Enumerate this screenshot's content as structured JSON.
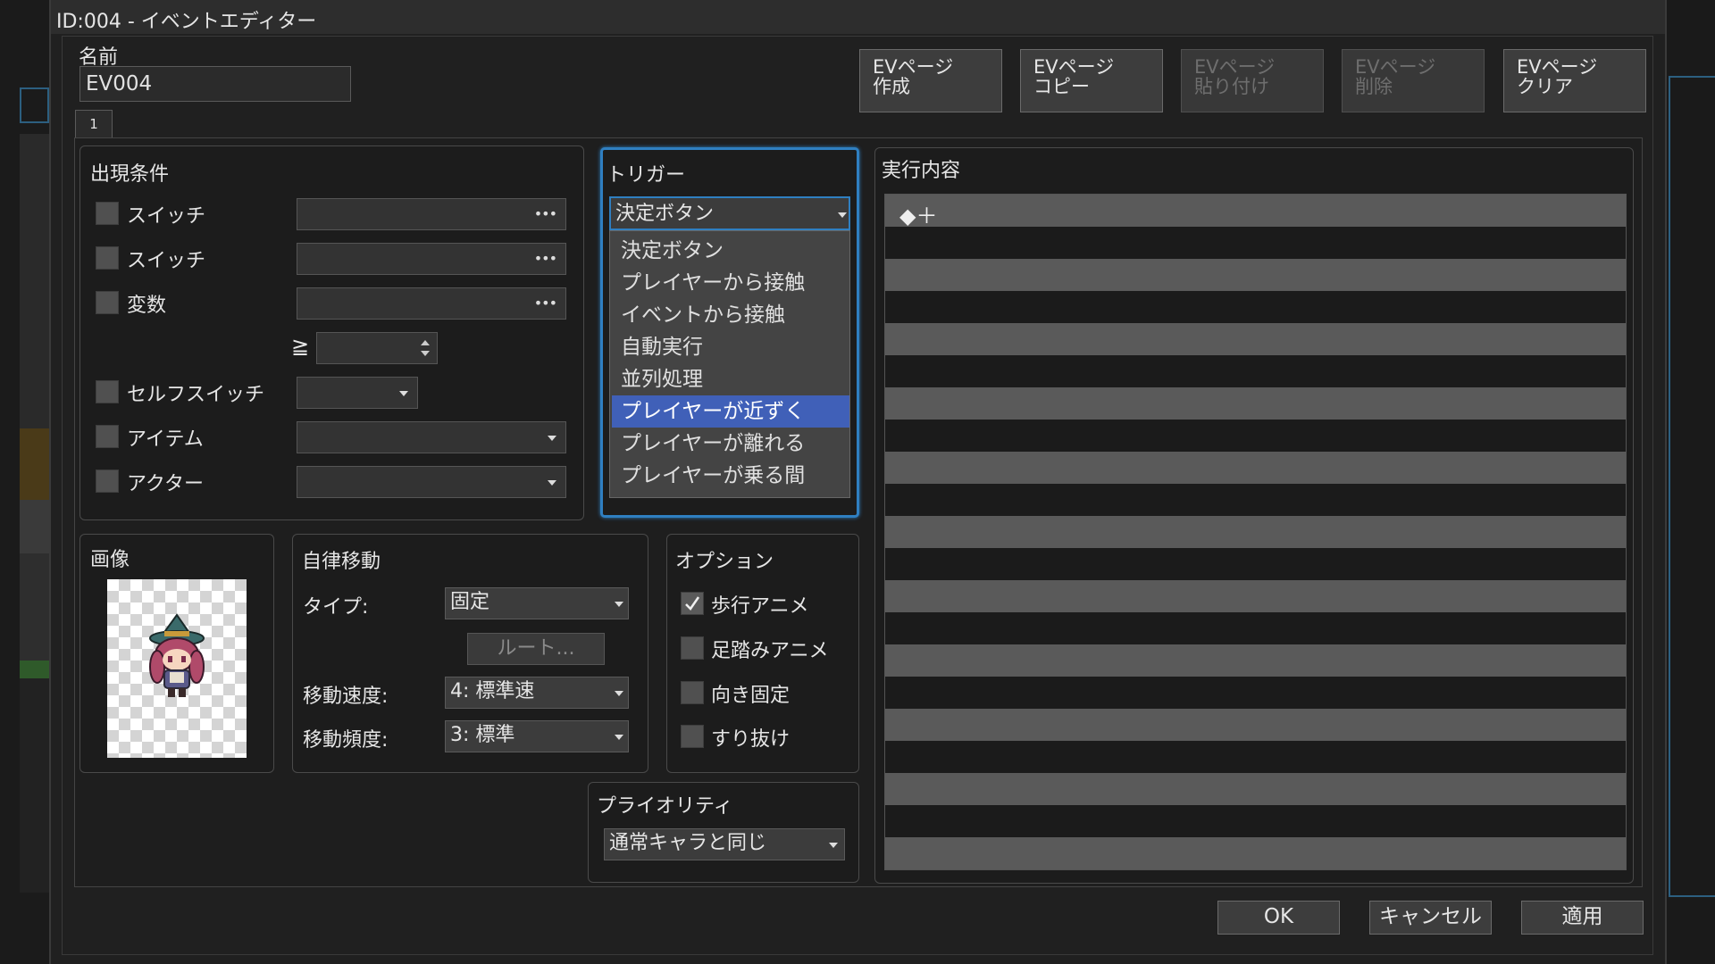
{
  "window": {
    "title": "ID:004 - イベントエディター"
  },
  "name": {
    "label": "名前",
    "value": "EV004"
  },
  "page_tab": "1",
  "page_buttons": [
    {
      "label": "EVページ\n作成",
      "enabled": true
    },
    {
      "label": "EVページ\nコピー",
      "enabled": true
    },
    {
      "label": "EVページ\n貼り付け",
      "enabled": false
    },
    {
      "label": "EVページ\n削除",
      "enabled": false
    },
    {
      "label": "EVページ\nクリア",
      "enabled": true
    }
  ],
  "conditions": {
    "title": "出現条件",
    "switch1": "スイッチ",
    "switch2": "スイッチ",
    "variable": "変数",
    "gte": "≧",
    "self_switch": "セルフスイッチ",
    "item": "アイテム",
    "actor": "アクター",
    "ellipsis": "•••"
  },
  "trigger": {
    "title": "トリガー",
    "selected": "決定ボタン",
    "options": [
      "決定ボタン",
      "プレイヤーから接触",
      "イベントから接触",
      "自動実行",
      "並列処理",
      "プレイヤーが近ずく",
      "プレイヤーが離れる",
      "プレイヤーが乗る間"
    ],
    "highlighted_index": 5
  },
  "contents": {
    "title": "実行内容",
    "first_line": "◆＋"
  },
  "image": {
    "title": "画像"
  },
  "movement": {
    "title": "自律移動",
    "type_label": "タイプ:",
    "type_value": "固定",
    "route_button": "ルート...",
    "speed_label": "移動速度:",
    "speed_value": "4: 標準速",
    "freq_label": "移動頻度:",
    "freq_value": "3: 標準"
  },
  "options": {
    "title": "オプション",
    "walking": "歩行アニメ",
    "walking_checked": true,
    "stepping": "足踏みアニメ",
    "stepping_checked": false,
    "direction_fix": "向き固定",
    "direction_fix_checked": false,
    "through": "すり抜け",
    "through_checked": false
  },
  "priority": {
    "title": "プライオリティ",
    "value": "通常キャラと同じ"
  },
  "dialog": {
    "ok": "OK",
    "cancel": "キャンセル",
    "apply": "適用"
  },
  "colors": {
    "highlight": "#4060b8",
    "focus_border": "#2f7fc1",
    "window_bg": "#202020"
  }
}
